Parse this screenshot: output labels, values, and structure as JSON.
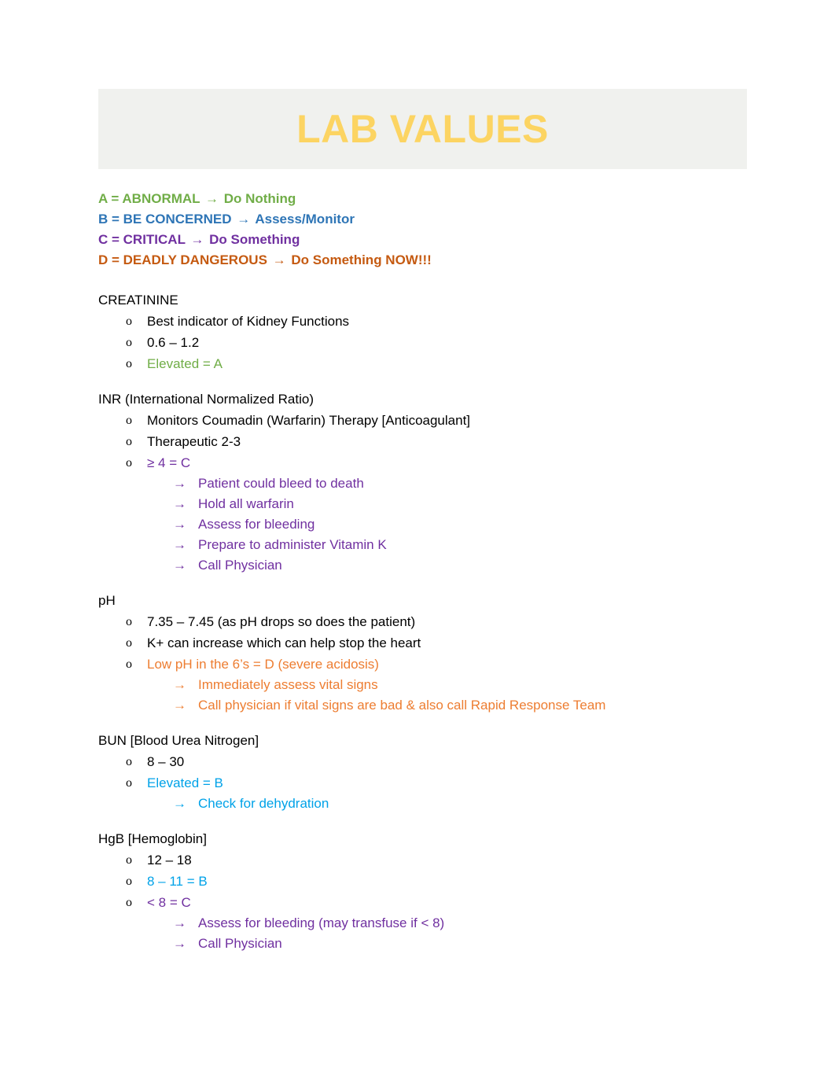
{
  "banner": {
    "title": "LAB VALUES",
    "bg_color": "#f0f1ee",
    "title_color": "#fcd462"
  },
  "legend": {
    "items": [
      {
        "code": "A = ABNORMAL ",
        "arrow": "→",
        "action": " Do Nothing",
        "color": "#70ad47"
      },
      {
        "code": "B = BE CONCERNED ",
        "arrow": "→",
        "action": " Assess/Monitor",
        "color": "#2e75b6"
      },
      {
        "code": "C = CRITICAL ",
        "arrow": "→",
        "action": " Do Something",
        "color": "#7030a0"
      },
      {
        "code": "D = DEADLY DANGEROUS ",
        "arrow": "→",
        "action": " Do Something NOW!!!",
        "color": "#c55a11"
      }
    ]
  },
  "colors": {
    "black": "#000000",
    "green_a": "#70ad47",
    "blue_b": "#00a2e8",
    "purple_c": "#7030a0",
    "orange_d": "#ed7d31"
  },
  "markers": {
    "bullet1": "o",
    "bullet2": "→"
  },
  "sections": [
    {
      "heading": "CREATININE",
      "bullets": [
        {
          "text": "Best indicator of Kidney Functions",
          "color": "#000000",
          "sub": []
        },
        {
          "text": "0.6 – 1.2",
          "color": "#000000",
          "sub": []
        },
        {
          "text": "Elevated = A",
          "color": "#70ad47",
          "sub": []
        }
      ]
    },
    {
      "heading": "INR (International Normalized Ratio)",
      "bullets": [
        {
          "text": "Monitors Coumadin (Warfarin) Therapy [Anticoagulant]",
          "color": "#000000",
          "sub": []
        },
        {
          "text": "Therapeutic 2-3",
          "color": "#000000",
          "sub": []
        },
        {
          "text": "≥ 4 = C",
          "color": "#7030a0",
          "sub": [
            {
              "text": "Patient could bleed to death",
              "color": "#7030a0"
            },
            {
              "text": "Hold all warfarin",
              "color": "#7030a0"
            },
            {
              "text": "Assess for bleeding",
              "color": "#7030a0"
            },
            {
              "text": "Prepare to administer Vitamin K",
              "color": "#7030a0"
            },
            {
              "text": "Call Physician",
              "color": "#7030a0"
            }
          ]
        }
      ]
    },
    {
      "heading": "pH",
      "bullets": [
        {
          "text": "7.35 – 7.45 (as pH drops so does the patient)",
          "color": "#000000",
          "sub": []
        },
        {
          "text": "K+ can increase which can help stop the heart",
          "color": "#000000",
          "sub": []
        },
        {
          "text": "Low pH in the 6’s = D (severe acidosis)",
          "color": "#ed7d31",
          "sub": [
            {
              "text": "Immediately assess vital signs",
              "color": "#ed7d31"
            },
            {
              "text": "Call physician if vital signs are bad & also call Rapid Response Team",
              "color": "#ed7d31"
            }
          ]
        }
      ]
    },
    {
      "heading": "BUN [Blood Urea Nitrogen]",
      "bullets": [
        {
          "text": "8 – 30",
          "color": "#000000",
          "sub": []
        },
        {
          "text": "Elevated = B",
          "color": "#00a2e8",
          "sub": [
            {
              "text": "Check for dehydration",
              "color": "#00a2e8"
            }
          ]
        }
      ]
    },
    {
      "heading": "HgB [Hemoglobin]",
      "bullets": [
        {
          "text": "12 – 18",
          "color": "#000000",
          "sub": []
        },
        {
          "text": "8 – 11 = B",
          "color": "#00a2e8",
          "sub": []
        },
        {
          "text": "< 8 = C",
          "color": "#7030a0",
          "sub": [
            {
              "text": "Assess for bleeding (may transfuse if < 8)",
              "color": "#7030a0"
            },
            {
              "text": "Call Physician",
              "color": "#7030a0"
            }
          ]
        }
      ]
    }
  ]
}
